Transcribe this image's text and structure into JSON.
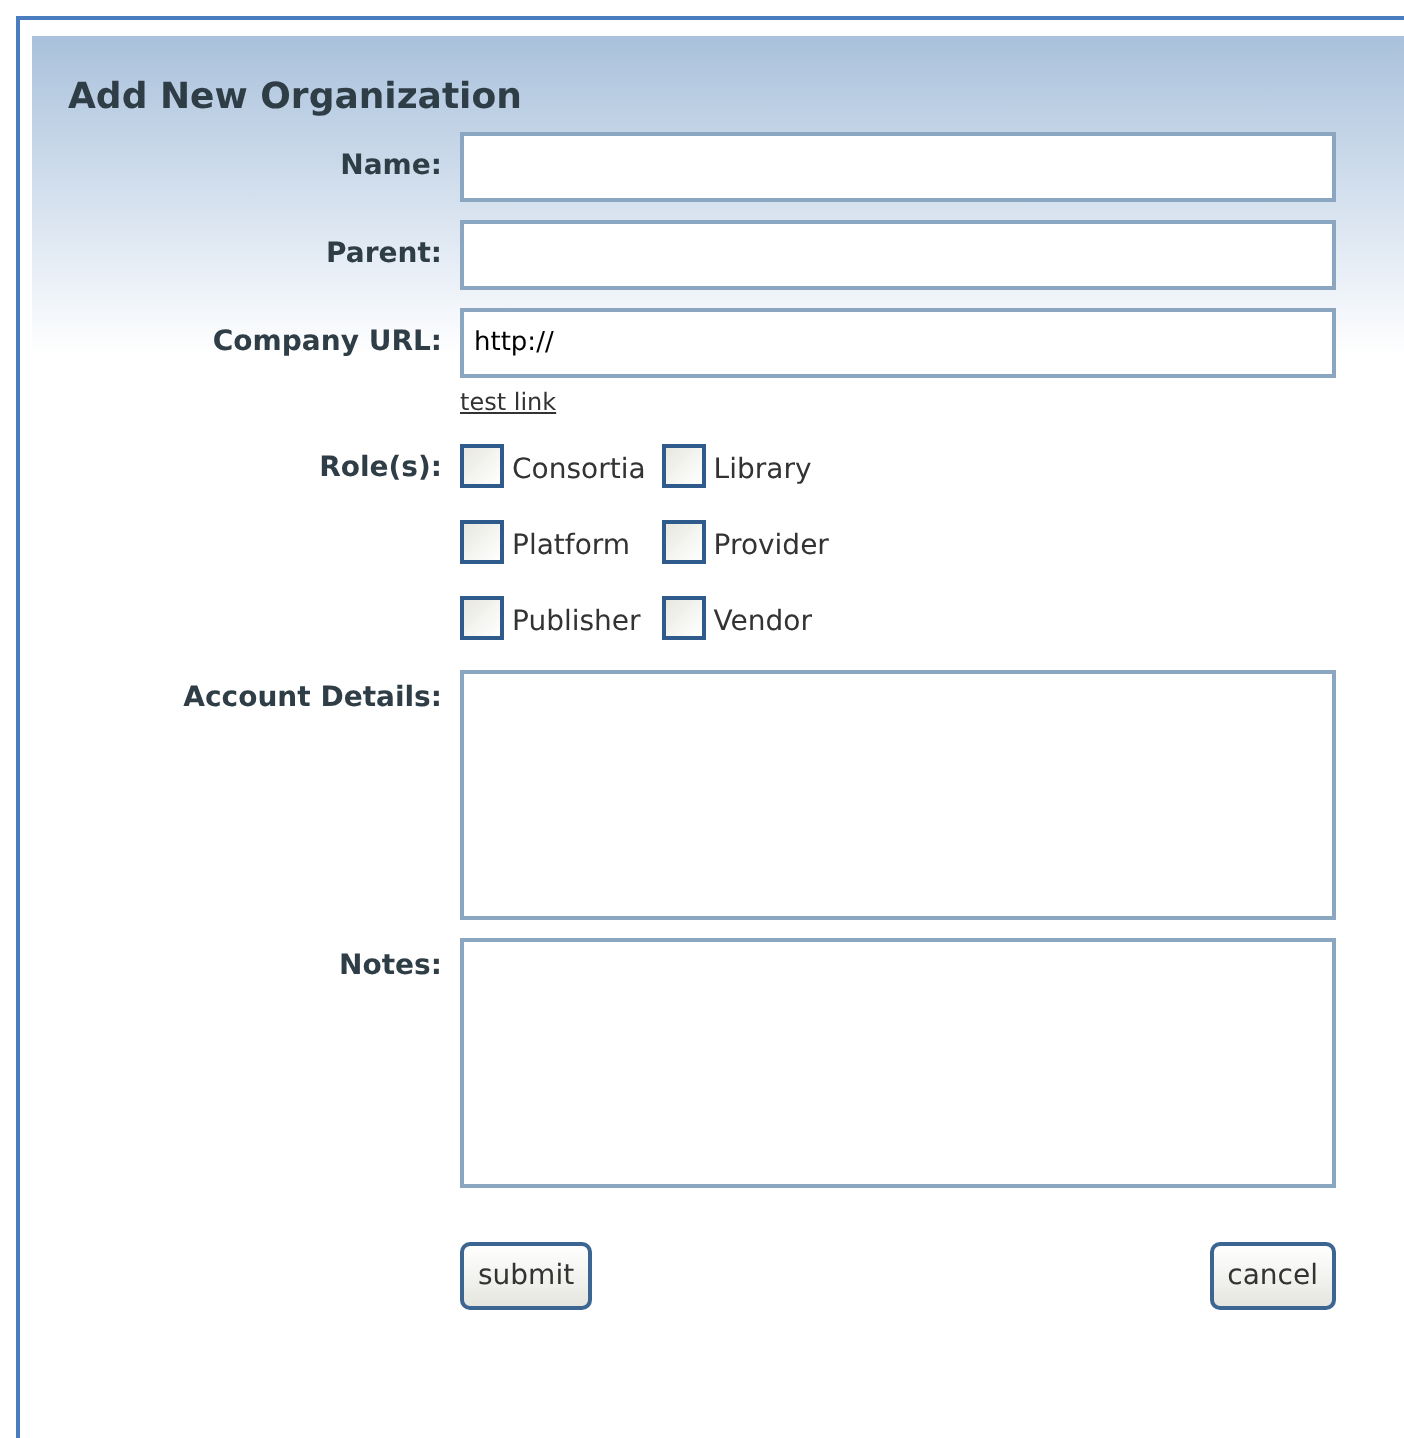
{
  "title": "Add New Organization",
  "fields": [
    {
      "label": "Name:",
      "kind": "text"
    },
    {
      "label": "Parent:",
      "kind": "text"
    },
    {
      "label": "Company URL:",
      "kind": "text",
      "value": "http://",
      "link": "test link"
    }
  ],
  "roles": {
    "label": "Role(s):",
    "options": [
      {
        "label": "Consortia",
        "checked": false
      },
      {
        "label": "Library",
        "checked": false
      },
      {
        "label": "Platform",
        "checked": false
      },
      {
        "label": "Provider",
        "checked": false
      },
      {
        "label": "Publisher",
        "checked": false
      },
      {
        "label": "Vendor",
        "checked": false
      }
    ]
  },
  "textareas": [
    {
      "label": "Account Details:"
    },
    {
      "label": "Notes:"
    }
  ],
  "buttons": [
    "submit",
    "cancel"
  ]
}
